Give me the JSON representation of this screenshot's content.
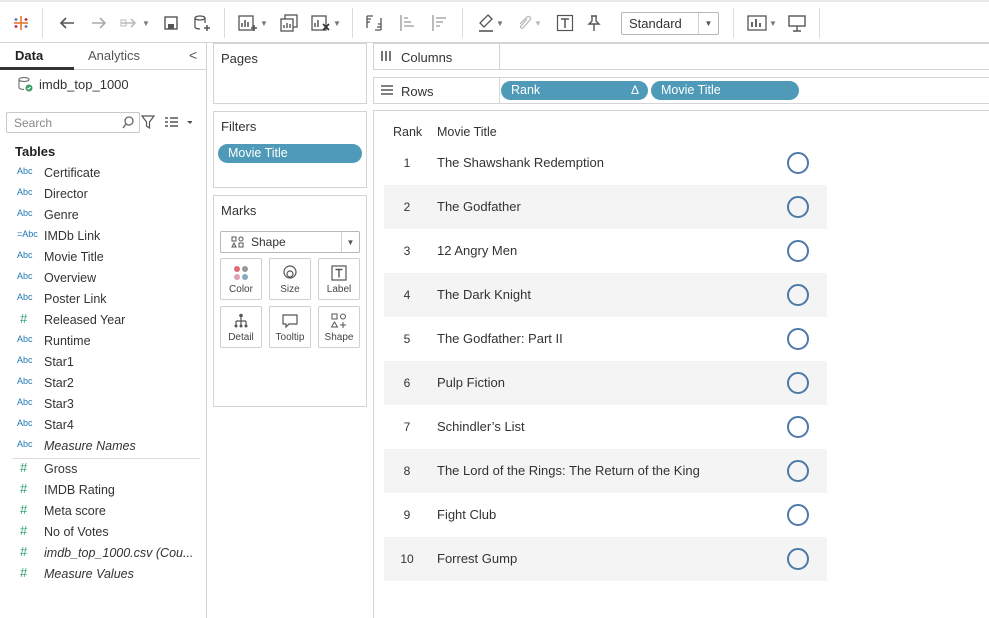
{
  "toolbar": {
    "fit_select": "Standard"
  },
  "data_pane": {
    "tabs": [
      "Data",
      "Analytics"
    ],
    "datasource": "imdb_top_1000",
    "search_placeholder": "Search",
    "tables_heading": "Tables",
    "dimensions": [
      {
        "type": "Abc",
        "name": "Certificate"
      },
      {
        "type": "Abc",
        "name": "Director"
      },
      {
        "type": "Abc",
        "name": "Genre"
      },
      {
        "type": "=Abc",
        "name": "IMDb Link"
      },
      {
        "type": "Abc",
        "name": "Movie Title"
      },
      {
        "type": "Abc",
        "name": "Overview"
      },
      {
        "type": "Abc",
        "name": "Poster Link"
      },
      {
        "type": "#",
        "name": "Released Year"
      },
      {
        "type": "Abc",
        "name": "Runtime"
      },
      {
        "type": "Abc",
        "name": "Star1"
      },
      {
        "type": "Abc",
        "name": "Star2"
      },
      {
        "type": "Abc",
        "name": "Star3"
      },
      {
        "type": "Abc",
        "name": "Star4"
      },
      {
        "type": "Abc",
        "name": "Measure Names",
        "italic": true
      }
    ],
    "measures": [
      {
        "type": "#",
        "name": "Gross"
      },
      {
        "type": "#",
        "name": "IMDB Rating"
      },
      {
        "type": "#",
        "name": "Meta score"
      },
      {
        "type": "#",
        "name": "No of Votes"
      },
      {
        "type": "#",
        "name": "imdb_top_1000.csv (Cou...",
        "italic": true
      },
      {
        "type": "#",
        "name": "Measure Values",
        "italic": true
      }
    ]
  },
  "cards": {
    "pages_title": "Pages",
    "filters_title": "Filters",
    "filter_pill": "Movie Title",
    "marks_title": "Marks",
    "mark_type": "Shape",
    "mark_buttons": [
      "Color",
      "Size",
      "Label",
      "Detail",
      "Tooltip",
      "Shape"
    ]
  },
  "shelves": {
    "columns_label": "Columns",
    "rows_label": "Rows",
    "rows_pills": [
      "Rank",
      "Movie Title"
    ],
    "rank_sort_glyph": "Δ"
  },
  "view": {
    "headers": [
      "Rank",
      "Movie Title"
    ],
    "mark_color": "#4e79a7",
    "rows": [
      {
        "rank": "1",
        "title": "The Shawshank Redemption"
      },
      {
        "rank": "2",
        "title": "The Godfather"
      },
      {
        "rank": "3",
        "title": "12 Angry Men"
      },
      {
        "rank": "4",
        "title": "The Dark Knight"
      },
      {
        "rank": "5",
        "title": "The Godfather: Part II"
      },
      {
        "rank": "6",
        "title": "Pulp Fiction"
      },
      {
        "rank": "7",
        "title": "Schindler’s List"
      },
      {
        "rank": "8",
        "title": "The Lord of the Rings: The Return of the King"
      },
      {
        "rank": "9",
        "title": "Fight Club"
      },
      {
        "rank": "10",
        "title": "Forrest Gump"
      }
    ]
  }
}
